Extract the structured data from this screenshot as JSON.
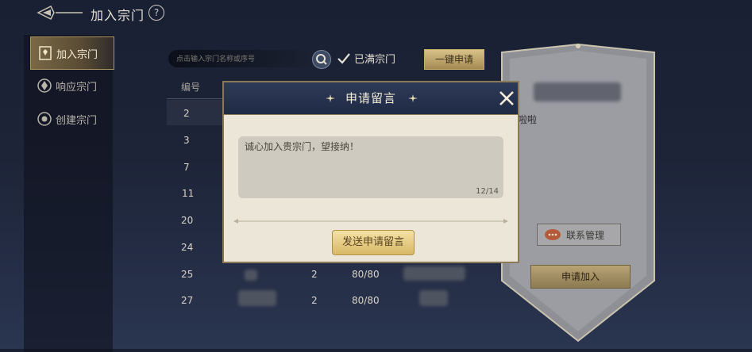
{
  "header": {
    "title": "加入宗门",
    "help": "?"
  },
  "nav": {
    "items": [
      {
        "label": "加入宗门"
      },
      {
        "label": "响应宗门"
      },
      {
        "label": "创建宗门"
      }
    ]
  },
  "search": {
    "placeholder": "点击输入宗门名称或序号",
    "full_label": "已满宗门",
    "onekey_label": "一键申请"
  },
  "table": {
    "header_id": "编号",
    "rows": [
      {
        "id": "2",
        "count": "",
        "cap": ""
      },
      {
        "id": "3",
        "count": "",
        "cap": ""
      },
      {
        "id": "7",
        "count": "",
        "cap": ""
      },
      {
        "id": "11",
        "count": "",
        "cap": ""
      },
      {
        "id": "20",
        "count": "",
        "cap": ""
      },
      {
        "id": "24",
        "count": "",
        "cap": ""
      },
      {
        "id": "25",
        "count": "2",
        "cap": "80/80"
      },
      {
        "id": "27",
        "count": "2",
        "cap": "80/80"
      }
    ]
  },
  "card": {
    "partial_text": "啦啦",
    "contact_label": "联系管理",
    "apply_label": "申请加入"
  },
  "modal": {
    "title": "申请留言",
    "message": "诚心加入贵宗门，望接纳！",
    "counter": "12/14",
    "send_label": "发送申请留言"
  },
  "colors": {
    "accent_gold": "#d7b866",
    "modal_header": "#1f2a44",
    "modal_body": "#ece6d8"
  }
}
